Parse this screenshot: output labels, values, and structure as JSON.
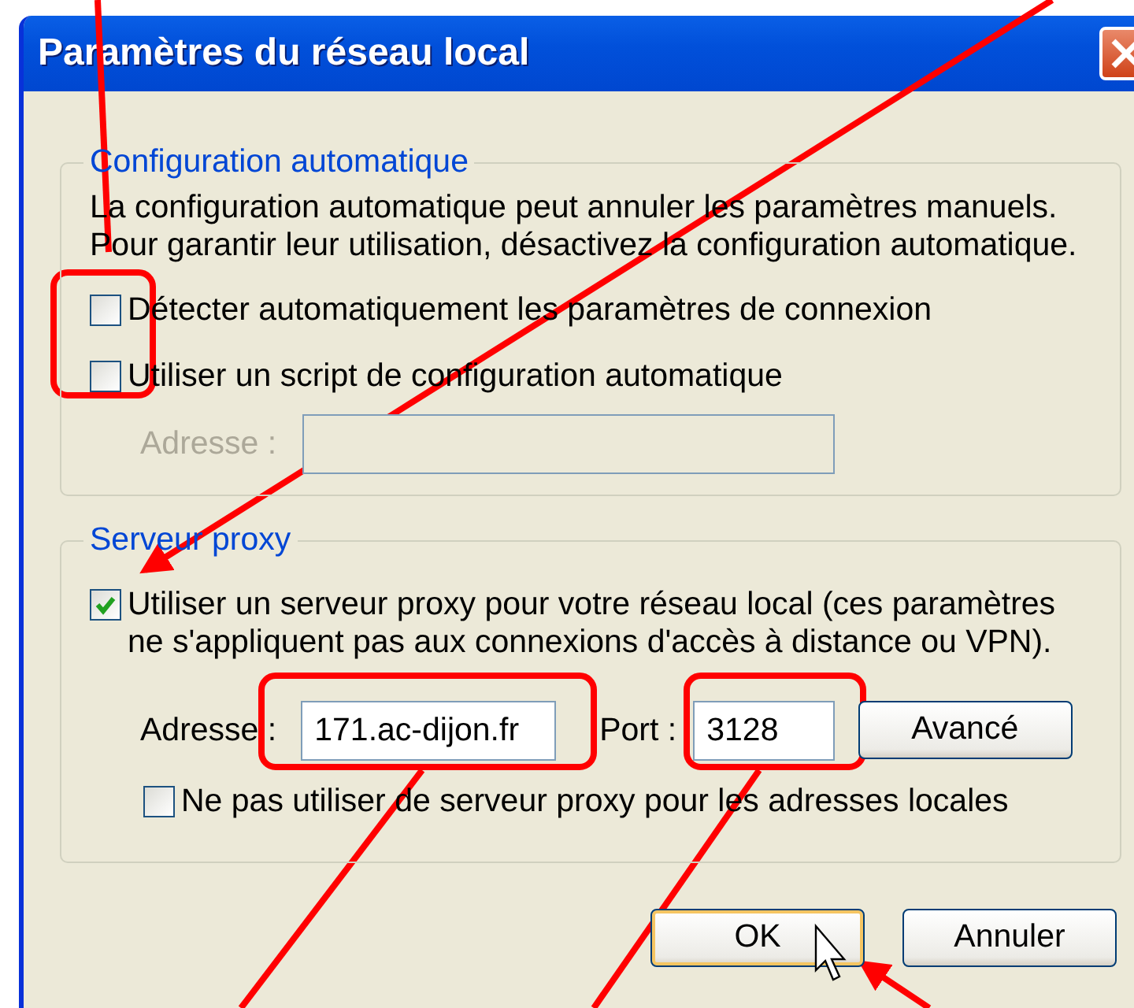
{
  "window": {
    "title": "Paramètres du réseau local"
  },
  "automatic_configuration": {
    "legend": "Configuration automatique",
    "description": [
      "La configuration automatique peut annuler les paramètres manuels.",
      "Pour garantir leur utilisation, désactivez la configuration automatique."
    ],
    "options": [
      {
        "label": "Détecter automatiquement les paramètres de connexion",
        "checked": false
      },
      {
        "label": "Utiliser un script de configuration automatique",
        "checked": false
      }
    ],
    "address": {
      "label": "Adresse :",
      "disabled": true
    }
  },
  "proxy_server": {
    "legend": "Serveur proxy",
    "use_proxy": {
      "lines": [
        "Utiliser un serveur proxy pour votre réseau local (ces paramètres",
        "ne s'appliquent pas aux connexions d'accès à distance ou VPN)."
      ],
      "checked": true
    },
    "address": {
      "label": "Adresse :",
      "value": "171.ac-dijon.fr"
    },
    "port": {
      "label": "Port :",
      "value": "3128"
    },
    "advanced_button": "Avancé",
    "bypass_local": {
      "label": "Ne pas utiliser de serveur proxy pour les adresses locales",
      "checked": false
    }
  },
  "buttons": [
    {
      "label": "OK",
      "default": true
    },
    {
      "label": "Annuler",
      "default": false
    }
  ]
}
